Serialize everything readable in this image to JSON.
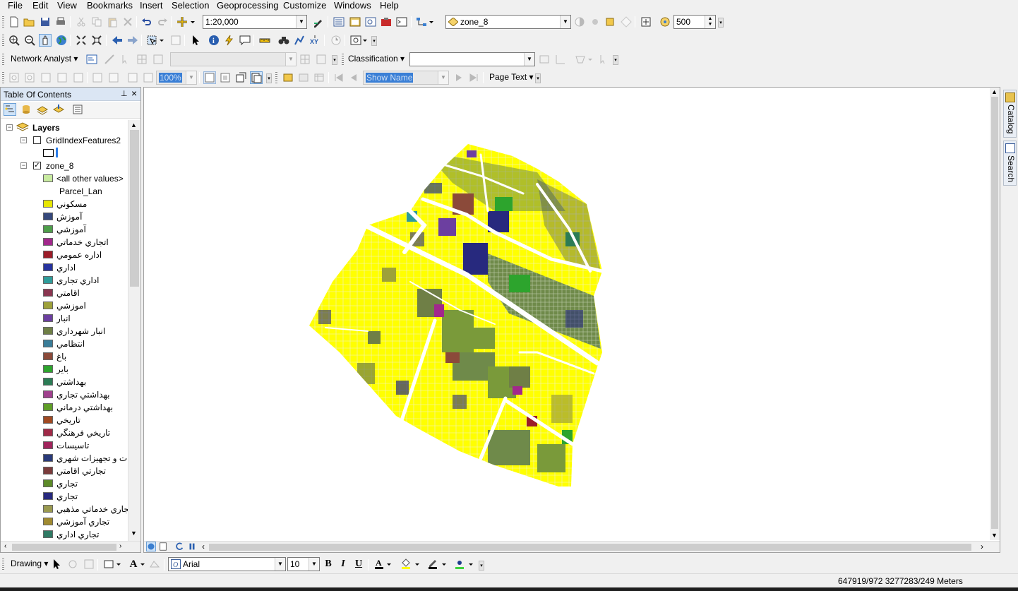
{
  "menubar": {
    "items": [
      "File",
      "Edit",
      "View",
      "Bookmarks",
      "Insert",
      "Selection",
      "Geoprocessing",
      "Customize",
      "Windows",
      "Help"
    ]
  },
  "standard_toolbar": {
    "scale_value": "1:20,000",
    "layer_combo": "zone_8",
    "tolerance_value": "500"
  },
  "tools_toolbar": {},
  "network_toolbar": {
    "network_analyst_label": "Network Analyst",
    "classification_label": "Classification",
    "classification_value": ""
  },
  "layout_toolbar": {
    "zoom_value": "100%",
    "show_name_value": "Show Name",
    "page_text_label": "Page Text"
  },
  "toc": {
    "title": "Table Of Contents",
    "root_label": "Layers",
    "layers": [
      {
        "name": "GridIndexFeatures2",
        "checked": false
      },
      {
        "name": "zone_8",
        "checked": true
      }
    ],
    "zone8_all_other": "<all other values>",
    "zone8_field": "Parcel_Lan",
    "classes": [
      {
        "label": "مسکوني",
        "color": "#e6e600"
      },
      {
        "label": "آموزش",
        "color": "#36497c"
      },
      {
        "label": "آموزشي",
        "color": "#4e9e4a"
      },
      {
        "label": "اتجاري خدماتي",
        "color": "#a2288c"
      },
      {
        "label": "اداره عمومي",
        "color": "#9b1c28"
      },
      {
        "label": "اداري",
        "color": "#27339e"
      },
      {
        "label": "اداري تجاري",
        "color": "#2f9c9a"
      },
      {
        "label": "اقامتي",
        "color": "#8a3650"
      },
      {
        "label": "اموزشي",
        "color": "#9ea13a"
      },
      {
        "label": "انبار",
        "color": "#6c3fa0"
      },
      {
        "label": "انبار شهرداري",
        "color": "#6f7f46"
      },
      {
        "label": "انتظامي",
        "color": "#3a7d98"
      },
      {
        "label": "باغ",
        "color": "#8b4a3a"
      },
      {
        "label": "باير",
        "color": "#2da42d"
      },
      {
        "label": "بهداشتي",
        "color": "#2c7c55"
      },
      {
        "label": "بهداشتي تجاري",
        "color": "#a0418e"
      },
      {
        "label": "بهداشتي درماني",
        "color": "#5f9e28"
      },
      {
        "label": "تاريخي",
        "color": "#a04a22"
      },
      {
        "label": "تاريخي فرهنگي",
        "color": "#a02a48"
      },
      {
        "label": "تاسيسات",
        "color": "#a0245c"
      },
      {
        "label": "تاسيسات و تجهيزات شهري",
        "color": "#2a3a7a"
      },
      {
        "label": "تجارتي اقامتي",
        "color": "#7a3b3b"
      },
      {
        "label": "تجاري",
        "color": "#5c8a28"
      },
      {
        "label": "تجاري",
        "color": "#27297e"
      },
      {
        "label": "تجاري خدماتي مذهبي",
        "color": "#9a9a50"
      },
      {
        "label": "تجاري آموزشي",
        "color": "#a08a30"
      },
      {
        "label": "تجاري اداري",
        "color": "#2f7a64"
      }
    ]
  },
  "dock": {
    "catalog_label": "Catalog",
    "search_label": "Search"
  },
  "draw_toolbar": {
    "drawing_label": "Drawing",
    "font_name": "Arial",
    "font_size": "10",
    "bold_label": "B",
    "italic_label": "I",
    "underline_label": "U",
    "text_icon_label": "A"
  },
  "status": {
    "coordinates": "647919/972  3277283/249 Meters"
  },
  "colors": {
    "residential_yellow": "#ffff00",
    "toc_header": "#dbe6f4"
  }
}
